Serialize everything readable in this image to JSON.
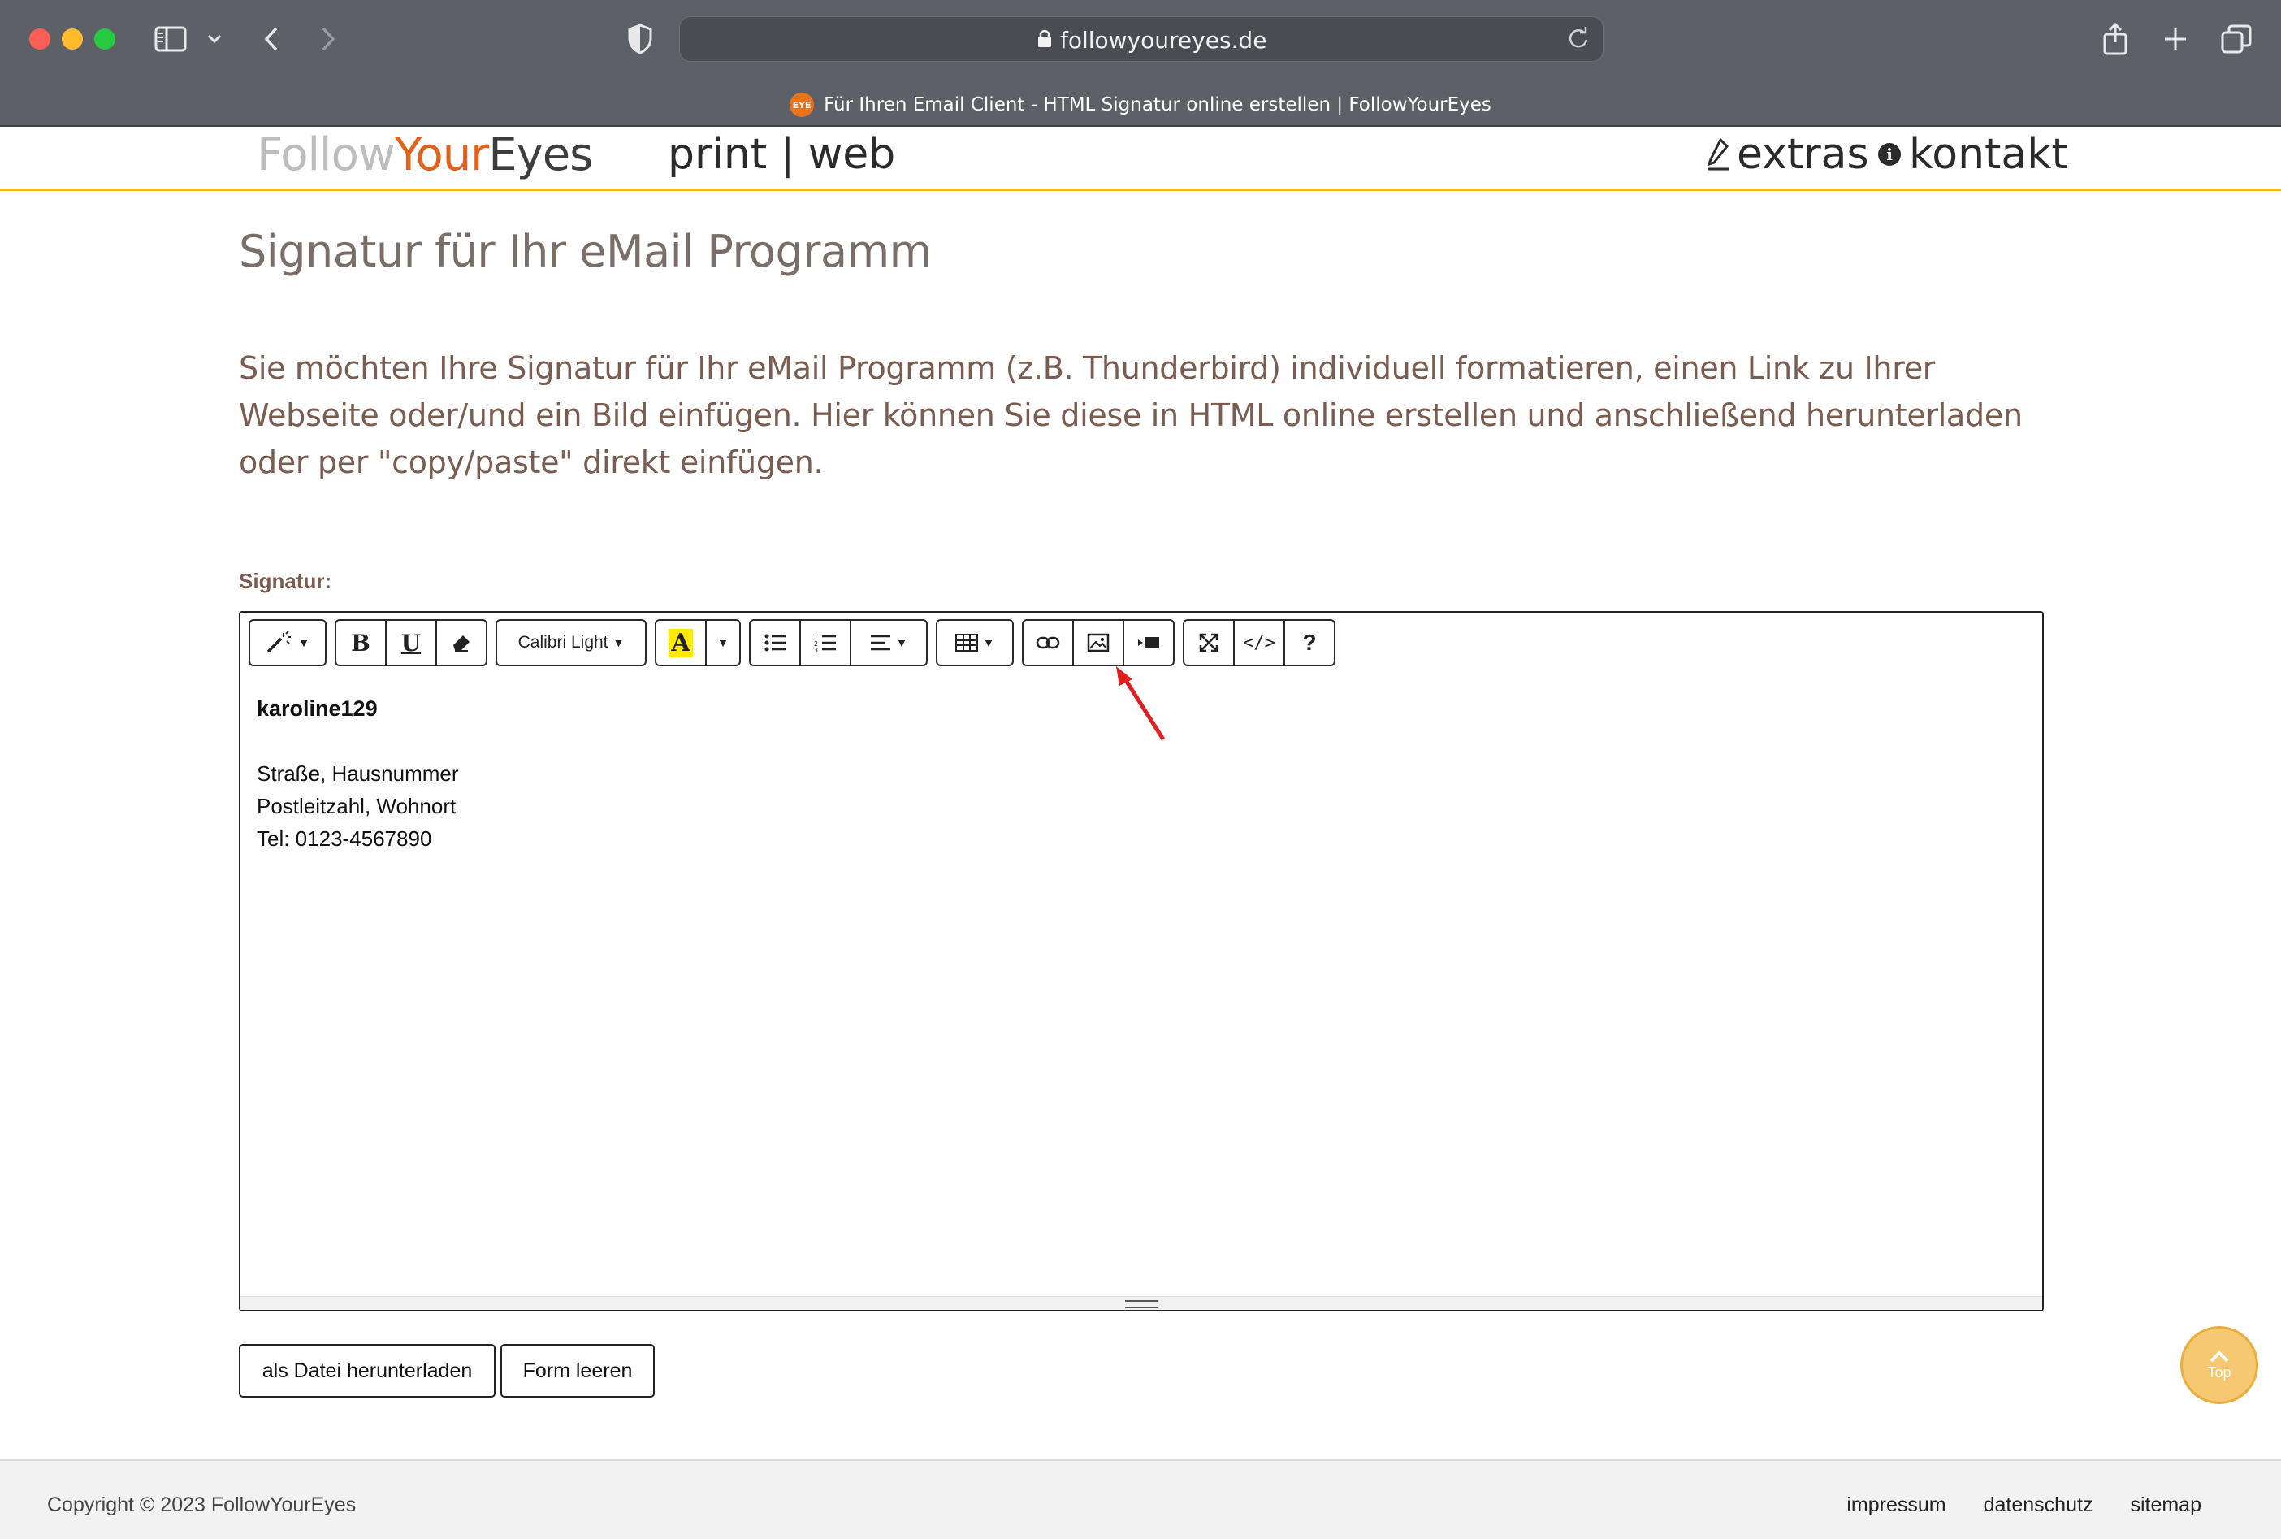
{
  "browser": {
    "url": "followyoureyes.de",
    "tab_title": "Für Ihren Email Client - HTML Signatur online erstellen | FollowYourEyes",
    "favicon_text": "EYE"
  },
  "site": {
    "logo": {
      "part1": "Follow",
      "part2": "Your",
      "part3": "Eyes"
    },
    "nav_print_web": "print | web",
    "nav_extras": "extras",
    "nav_kontakt": "kontakt"
  },
  "page": {
    "title": "Signatur für Ihr eMail Programm",
    "intro": "Sie möchten Ihre Signatur für Ihr eMail Programm (z.B. Thunderbird) individuell formatieren, einen Link zu Ihrer Webseite oder/und ein Bild  einfügen. Hier können Sie diese in HTML online erstellen und anschließend herunterladen oder per \"copy/paste\" direkt einfügen.",
    "signature_label": "Signatur:"
  },
  "editor": {
    "font_name": "Calibri Light",
    "bold_label": "B",
    "underline_label": "U",
    "help_label": "?",
    "code_label": "</>",
    "content": {
      "name": "karoline129",
      "line1": "Straße, Hausnummer",
      "line2": "Postleitzahl, Wohnort",
      "line3": "Tel: 0123-4567890"
    }
  },
  "actions": {
    "download": "als Datei herunterladen",
    "clear": "Form leeren"
  },
  "top_button": "Top",
  "footer": {
    "copyright": "Copyright © 2023 FollowYourEyes",
    "links": [
      "impressum",
      "datenschutz",
      "sitemap"
    ]
  },
  "colors": {
    "logo_grey": "#bdbdbd",
    "logo_orange": "#e0621c",
    "accent_yellow": "#f0b81e",
    "title_color": "#7a6e68",
    "text_brown": "#7a5d50",
    "annotation_red": "#e02020"
  }
}
